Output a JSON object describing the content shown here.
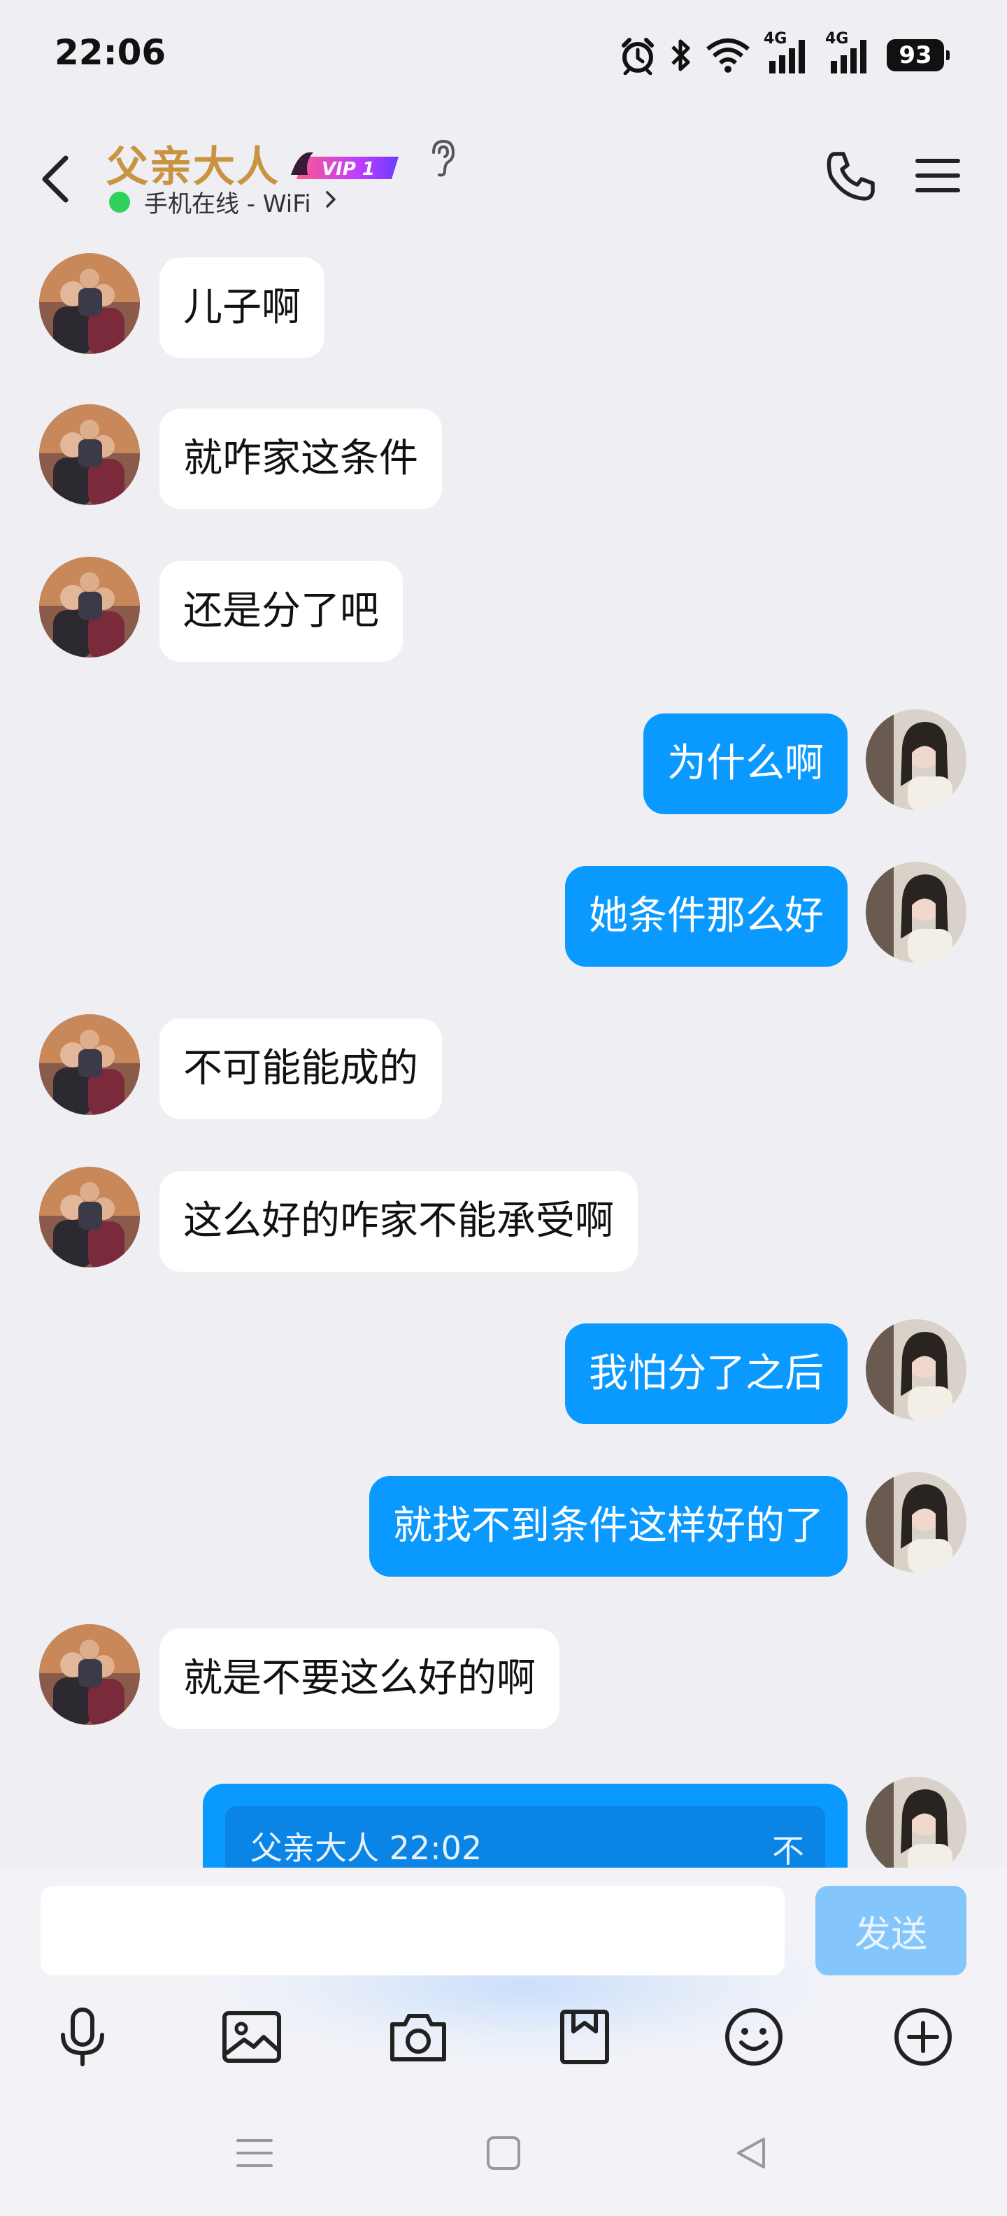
{
  "status_bar": {
    "time": "22:06",
    "battery": "93",
    "network_1": "4G",
    "network_2": "4G",
    "icons": [
      "alarm-icon",
      "bluetooth-icon",
      "wifi-icon",
      "signal-icon",
      "signal-icon",
      "battery-icon"
    ]
  },
  "header": {
    "title": "父亲大人",
    "vip_badge": "VIP 1",
    "status_text": "手机在线 - WiFi",
    "online_color": "#2fd35c",
    "title_color": "#c89441"
  },
  "messages": [
    {
      "side": "left",
      "text": "儿子啊"
    },
    {
      "side": "left",
      "text": "就咋家这条件"
    },
    {
      "side": "left",
      "text": "还是分了吧"
    },
    {
      "side": "right",
      "text": "为什么啊"
    },
    {
      "side": "right",
      "text": "她条件那么好"
    },
    {
      "side": "left",
      "text": "不可能能成的"
    },
    {
      "side": "left",
      "text": "这么好的咋家不能承受啊"
    },
    {
      "side": "right",
      "text": "我怕分了之后"
    },
    {
      "side": "right",
      "text": "就找不到条件这样好的了"
    },
    {
      "side": "left",
      "text": "就是不要这么好的啊"
    }
  ],
  "quote_message": {
    "meta": "父亲大人 22:02",
    "first_char": "不"
  },
  "input": {
    "value": "",
    "send_label": "发送"
  },
  "toolbar": [
    "voice-icon",
    "image-icon",
    "camera-icon",
    "file-icon",
    "emoji-icon",
    "plus-icon"
  ],
  "colors": {
    "bubble_out": "#0a99ff",
    "bubble_in": "#ffffff",
    "background": "#eeeef3",
    "send_button": "#84c6fb"
  }
}
